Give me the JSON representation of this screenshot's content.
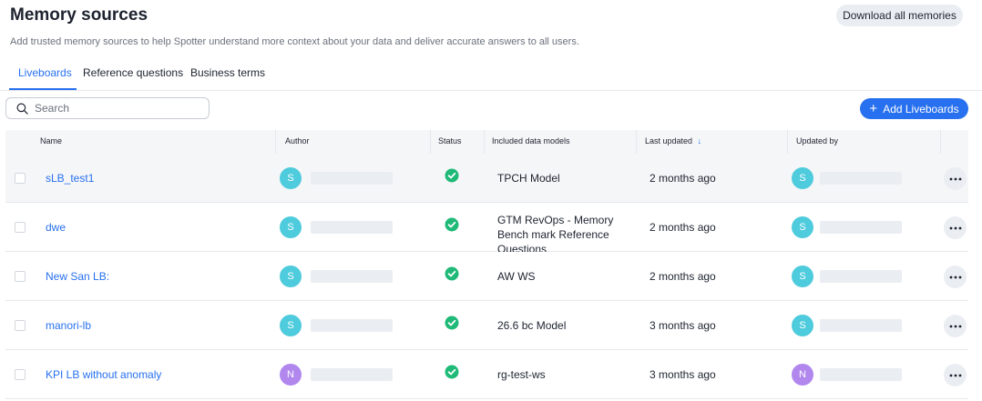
{
  "header": {
    "title": "Memory sources",
    "download_label": "Download all memories",
    "subtitle": "Add trusted memory sources to help Spotter understand more context about your data and deliver accurate answers to all users."
  },
  "tabs": [
    {
      "label": "Liveboards",
      "active": true
    },
    {
      "label": "Reference questions",
      "active": false
    },
    {
      "label": "Business terms",
      "active": false
    }
  ],
  "search": {
    "placeholder": "Search",
    "value": ""
  },
  "toolbar": {
    "add_label": "Add Liveboards"
  },
  "table": {
    "columns": {
      "name": "Name",
      "author": "Author",
      "status": "Status",
      "models": "Included data models",
      "last_updated": "Last updated",
      "sort_arrow": "↓",
      "updated_by": "Updated by"
    },
    "rows": [
      {
        "name": "sLB_test1",
        "author_initial": "S",
        "author_color": "#4ecbdc",
        "status": "success-check-icon",
        "models": "TPCH Model",
        "last_updated": "2 months ago",
        "updater_initial": "S",
        "updater_color": "#4ecbdc"
      },
      {
        "name": "dwe",
        "author_initial": "S",
        "author_color": "#4ecbdc",
        "status": "success-check-icon",
        "models": "GTM RevOps - Memory Bench mark Reference Questions",
        "last_updated": "2 months ago",
        "updater_initial": "S",
        "updater_color": "#4ecbdc"
      },
      {
        "name": "New San LB:",
        "author_initial": "S",
        "author_color": "#4ecbdc",
        "status": "success-check-icon",
        "models": "AW WS",
        "last_updated": "2 months ago",
        "updater_initial": "S",
        "updater_color": "#4ecbdc"
      },
      {
        "name": "manori-lb",
        "author_initial": "S",
        "author_color": "#4ecbdc",
        "status": "success-check-icon",
        "models": "26.6 bc Model",
        "last_updated": "3 months ago",
        "updater_initial": "S",
        "updater_color": "#4ecbdc"
      },
      {
        "name": "KPI LB without anomaly",
        "author_initial": "N",
        "author_color": "#b187ee",
        "status": "success-check-icon",
        "models": "rg-test-ws",
        "last_updated": "3 months ago",
        "updater_initial": "N",
        "updater_color": "#b187ee"
      }
    ]
  },
  "colors": {
    "accent": "#2770ef",
    "success": "#1fb978"
  }
}
